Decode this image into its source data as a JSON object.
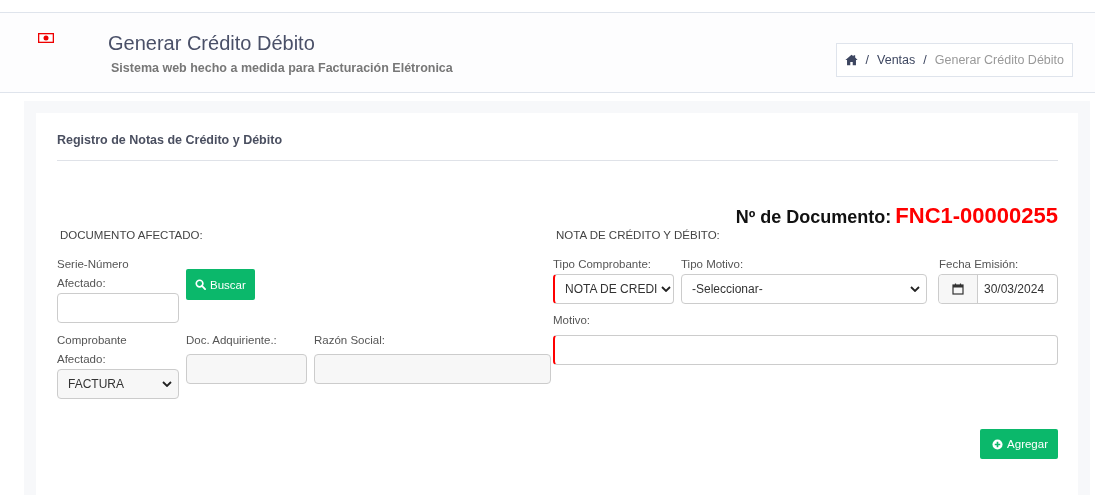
{
  "header": {
    "title": "Generar Crédito Débito",
    "subtitle": "Sistema web hecho a medida para Facturación Elétronica"
  },
  "breadcrumb_separator": "/",
  "breadcrumb": [
    {
      "label": "Ventas",
      "current": false
    },
    {
      "label": "Generar Crédito Débito",
      "current": true
    }
  ],
  "card": {
    "title": "Registro de Notas de Crédito y Débito",
    "doc_label": "Nº de Documento:",
    "doc_number": "FNC1-00000255"
  },
  "documento_afectado": {
    "heading": "DOCUMENTO AFECTADO:",
    "serie_label": "Serie-Número Afectado:",
    "search_button": "Buscar",
    "comprobante_label": "Comprobante Afectado:",
    "comprobante_value": "FACTURA",
    "doc_label": "Doc. Adquiriente.:",
    "razon_label": "Razón Social:"
  },
  "nota": {
    "heading": "NOTA DE CRÉDITO Y DÉBITO:",
    "fields": [
      {
        "label": "Tipo Comprobante:",
        "value": "NOTA DE CREDI",
        "invalid": true
      },
      {
        "label": "Tipo Motivo:",
        "value": "-Seleccionar-",
        "invalid": false
      }
    ],
    "fecha_label": "Fecha Emisión:",
    "fecha_value": "30/03/2024",
    "motivo_label": "Motivo:",
    "motivo_invalid": true,
    "add_button": "Agregar"
  }
}
